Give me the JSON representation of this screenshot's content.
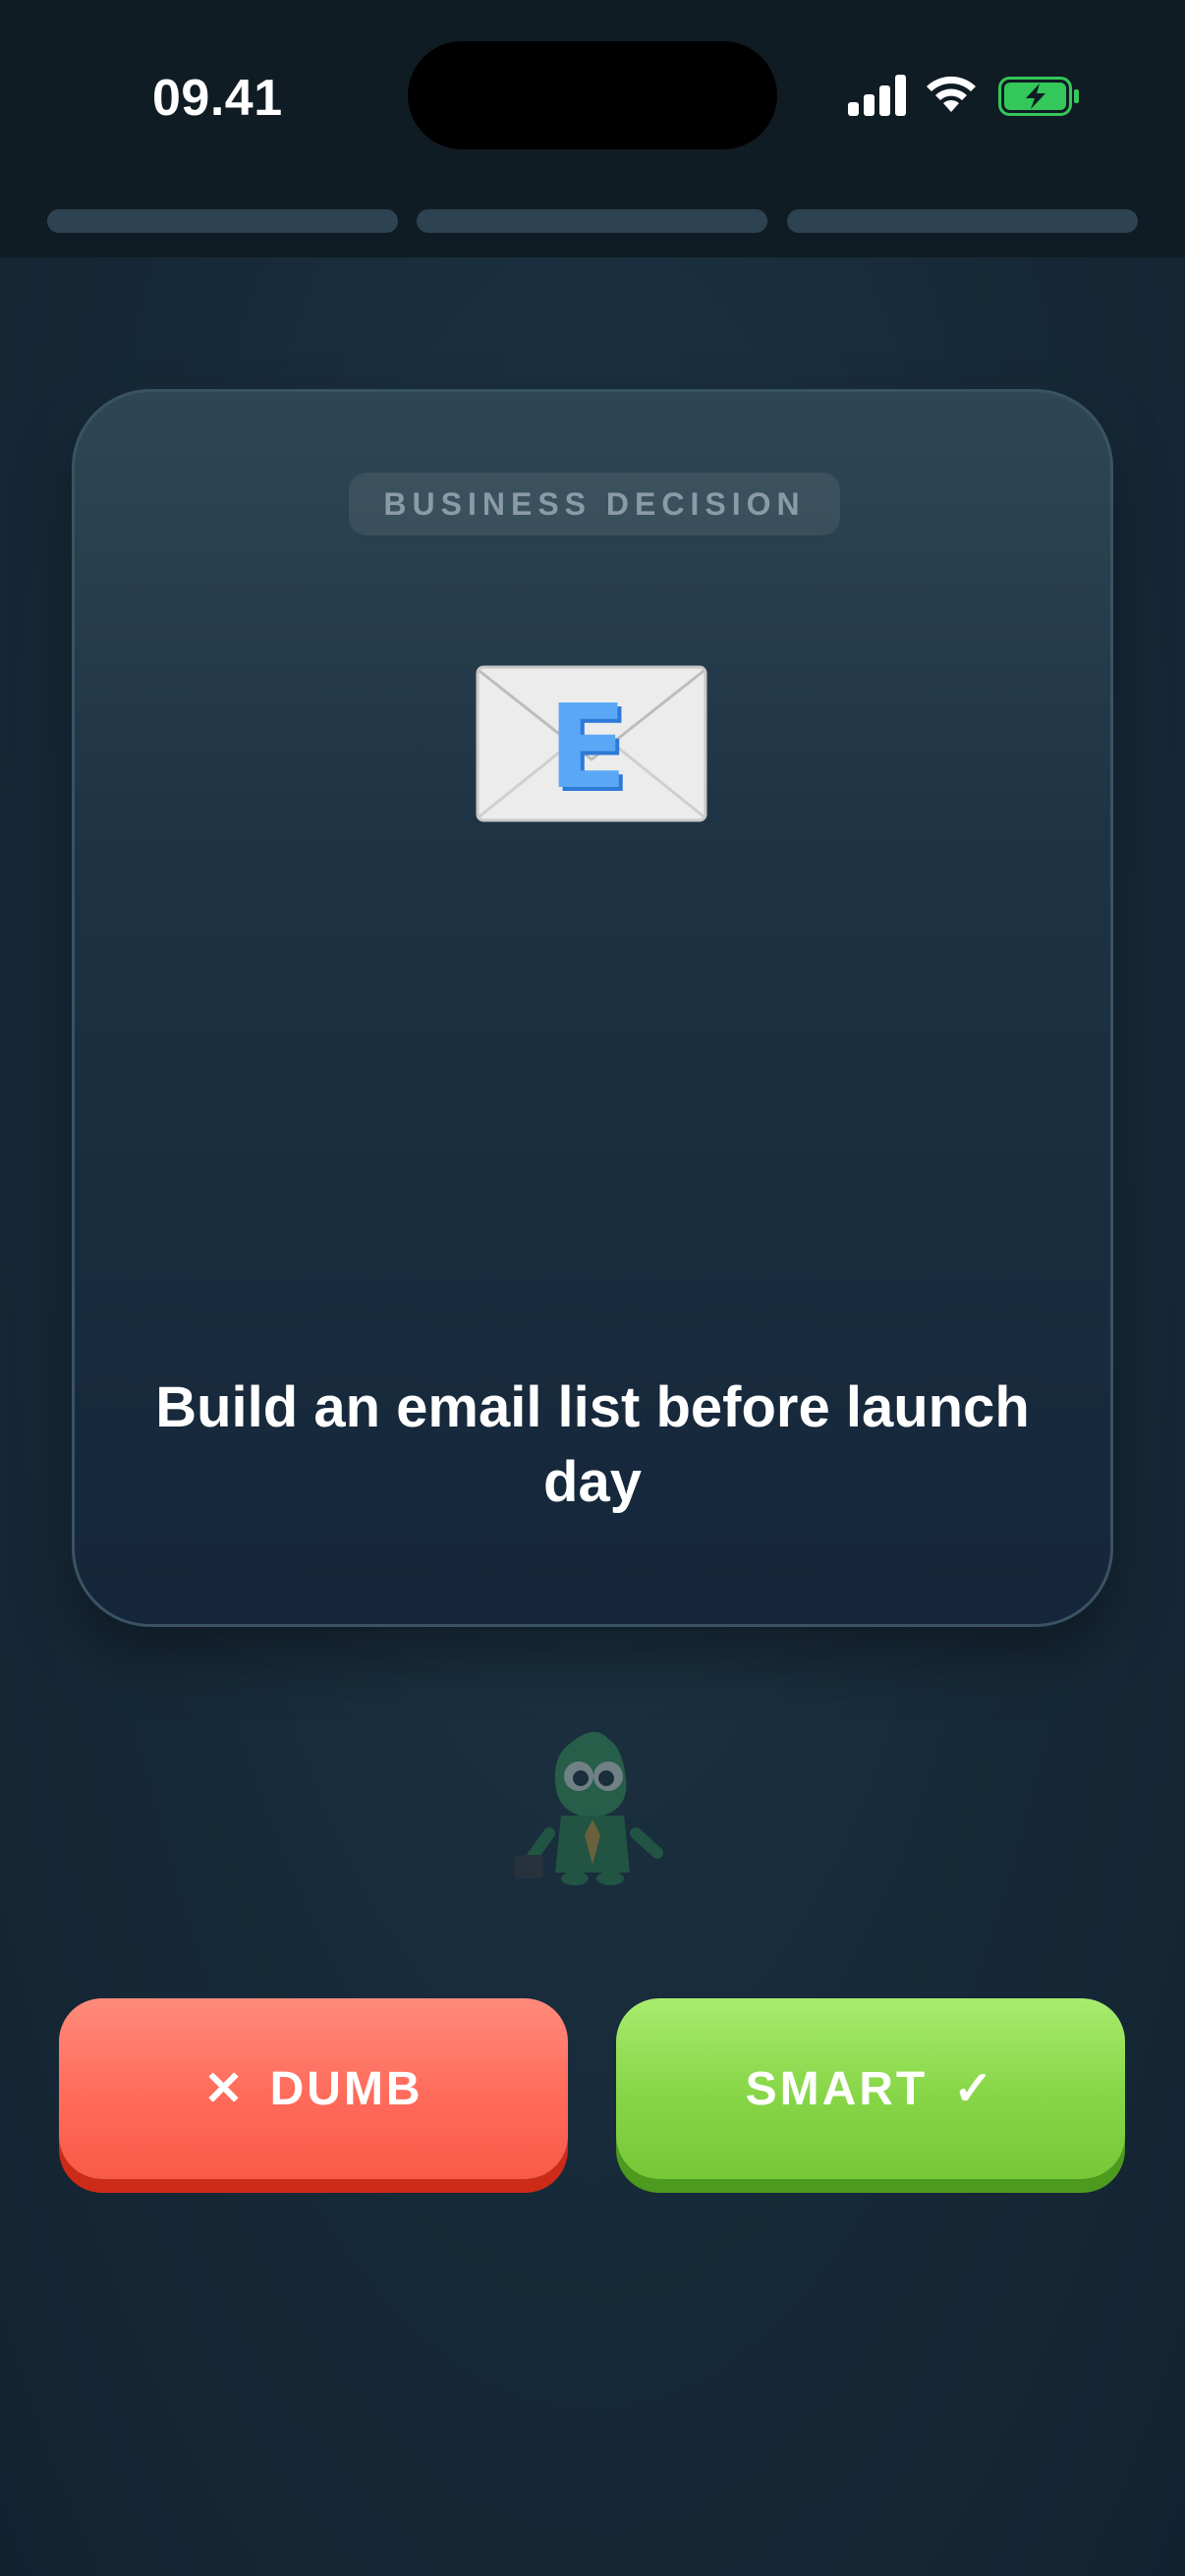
{
  "status_bar": {
    "time": "09.41",
    "signal_icon": "cellular-signal-icon",
    "wifi_icon": "wifi-icon",
    "battery_icon": "battery-charging-icon",
    "battery_color": "#34c759"
  },
  "progress": {
    "total_segments": 3,
    "completed_segments": 0
  },
  "card": {
    "tag": "BUSINESS DECISION",
    "icon": "e-mail-envelope-icon",
    "statement": "Build an email list before launch day"
  },
  "mascot": {
    "icon": "green-mascot-icon"
  },
  "buttons": {
    "dumb": {
      "icon": "✕",
      "label": "DUMB",
      "color": "#ff6a5a"
    },
    "smart": {
      "label": "SMART",
      "icon": "✓",
      "color": "#86d546"
    }
  }
}
